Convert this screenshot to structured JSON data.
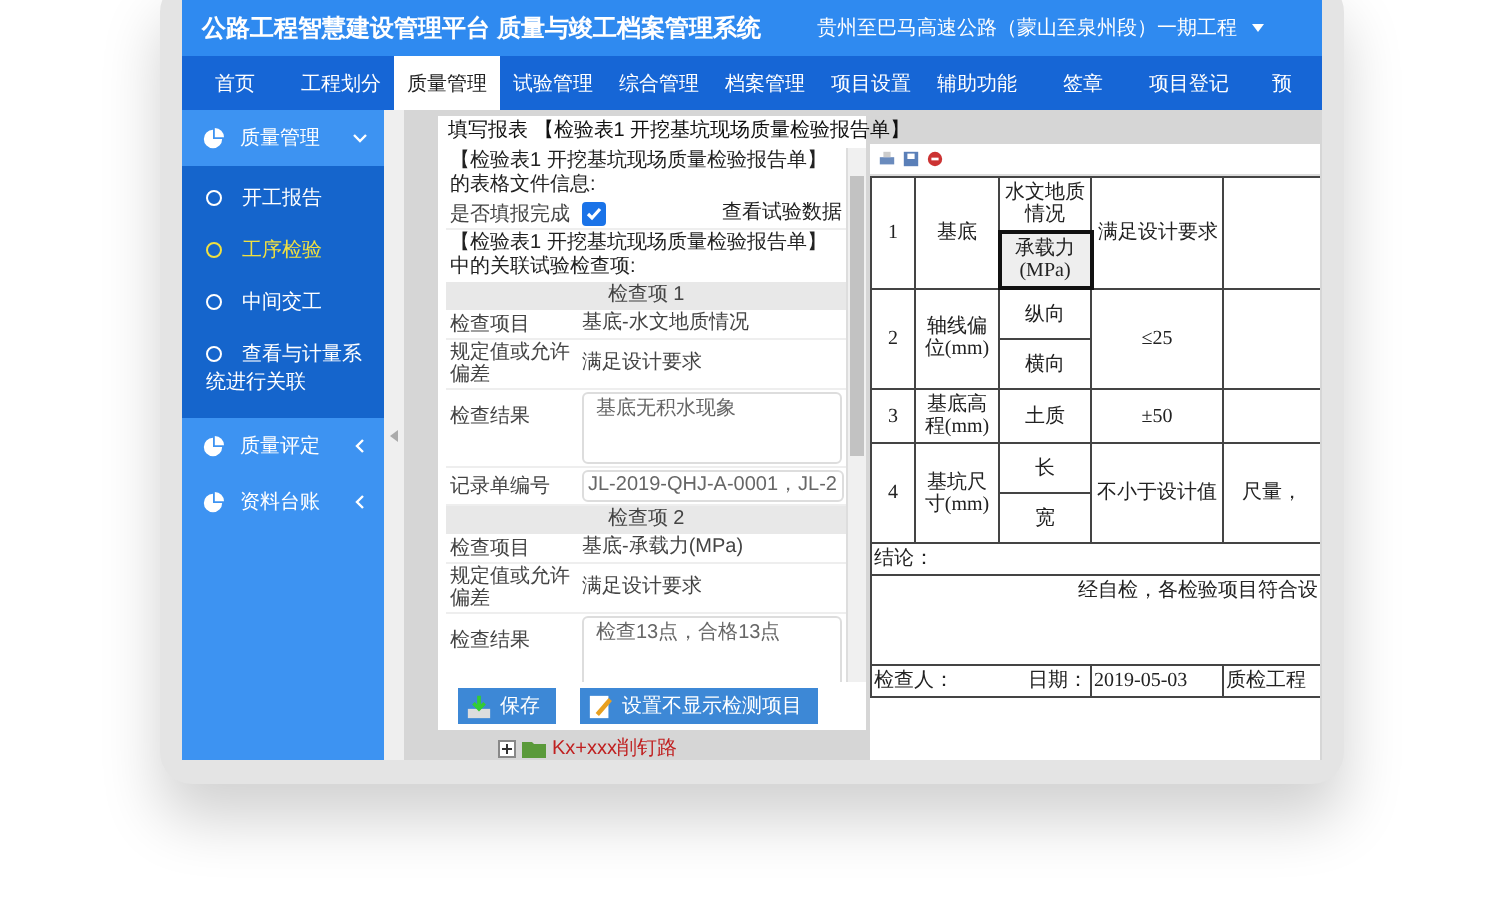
{
  "header": {
    "title": "公路工程智慧建设管理平台 质量与竣工档案管理系统",
    "project": "贵州至巴马高速公路（蒙山至泉州段）一期工程"
  },
  "nav": [
    {
      "label": "首页",
      "selected": false
    },
    {
      "label": "工程划分",
      "selected": false
    },
    {
      "label": "质量管理",
      "selected": true
    },
    {
      "label": "试验管理",
      "selected": false
    },
    {
      "label": "综合管理",
      "selected": false
    },
    {
      "label": "档案管理",
      "selected": false
    },
    {
      "label": "项目设置",
      "selected": false
    },
    {
      "label": "辅助功能",
      "selected": false
    },
    {
      "label": "签章",
      "selected": false
    },
    {
      "label": "项目登记",
      "selected": false
    },
    {
      "label": "预",
      "selected": false
    }
  ],
  "sidebar": [
    {
      "label": "质量管理",
      "expanded": true,
      "children": [
        {
          "label": "开工报告",
          "selected": false
        },
        {
          "label": "工序检验",
          "selected": true
        },
        {
          "label": "中间交工",
          "selected": false
        },
        {
          "label": "查看与计量系统进行关联",
          "selected": false
        }
      ]
    },
    {
      "label": "质量评定",
      "expanded": false
    },
    {
      "label": "资料台账",
      "expanded": false
    }
  ],
  "form": {
    "title": "填写报表 【检验表1 开挖基坑现场质量检验报告单】",
    "info_heading": "【检验表1 开挖基坑现场质量检验报告单】的表格文件信息:",
    "complete_label": "是否填报完成",
    "complete_checked": true,
    "view_link": "查看试验数据",
    "related_heading": "【检验表1 开挖基坑现场质量检验报告单】中的关联试验检查项:",
    "items": [
      {
        "heading": "检查项 1",
        "rows": [
          {
            "kind": "text",
            "label": "检查项目",
            "value": "基底-水文地质情况"
          },
          {
            "kind": "text",
            "label": "规定值或允许偏差",
            "value": "满足设计要求"
          },
          {
            "kind": "textarea",
            "label": "检查结果",
            "value": "基底无积水现象"
          },
          {
            "kind": "input",
            "label": "记录单编号",
            "value": "JL-2019-QHJ-A-0001，JL-2"
          }
        ]
      },
      {
        "heading": "检查项 2",
        "rows": [
          {
            "kind": "text",
            "label": "检查项目",
            "value": "基底-承载力(MPa)"
          },
          {
            "kind": "text",
            "label": "规定值或允许偏差",
            "value": "满足设计要求"
          },
          {
            "kind": "textarea",
            "label": "检查结果",
            "value": "检查13点，合格13点"
          }
        ]
      }
    ],
    "buttons": [
      {
        "kind": "save",
        "label": "保存"
      },
      {
        "kind": "edit",
        "label": "设置不显示检测项目"
      }
    ],
    "tree_item": "Kx+xxx削钉路"
  },
  "document": {
    "rows": [
      {
        "no": "1",
        "item": "基底",
        "subs": [
          {
            "text": "水文地质情况",
            "selected": false
          },
          {
            "text": "承载力(MPa)",
            "selected": true
          }
        ],
        "requirement": "满足设计要求",
        "column_5": ""
      },
      {
        "no": "2",
        "item": "轴线偏位(mm)",
        "subs": [
          {
            "text": "纵向",
            "selected": false
          },
          {
            "text": "横向",
            "selected": false
          }
        ],
        "requirement": "≤25",
        "column_5": ""
      },
      {
        "no": "3",
        "item": "基底高程(mm)",
        "subs": [
          {
            "text": "土质",
            "selected": false
          }
        ],
        "requirement": "±50",
        "column_5": ""
      },
      {
        "no": "4",
        "item": "基坑尺寸(mm)",
        "subs": [
          {
            "text": "长",
            "selected": false
          },
          {
            "text": "宽",
            "selected": false
          }
        ],
        "requirement": "不小于设计值",
        "column_5": "尺量，"
      }
    ],
    "conclusion_label": "结论：",
    "conclusion": "经自检，各检验项目符合设",
    "inspector_label": "检查人：",
    "date_label": "日期：",
    "date": "2019-05-03",
    "engineer_label": "质检工程"
  }
}
